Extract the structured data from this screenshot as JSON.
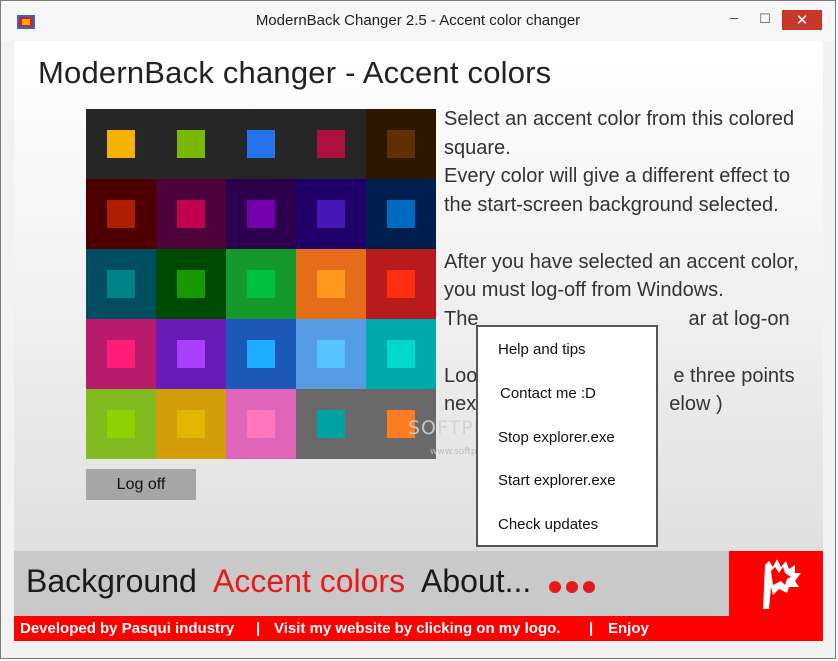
{
  "window": {
    "title": "ModernBack Changer 2.5 - Accent color changer",
    "controls": {
      "minimize": "─",
      "maximize": "☐",
      "close": "✕"
    }
  },
  "main": {
    "heading": "ModernBack changer - Accent colors",
    "grid": [
      {
        "bg": "#262626",
        "swatch": "#f4b300"
      },
      {
        "bg": "#262626",
        "swatch": "#78ba00"
      },
      {
        "bg": "#262626",
        "swatch": "#2673ec"
      },
      {
        "bg": "#262626",
        "swatch": "#ae113d"
      },
      {
        "bg": "#2d1700",
        "swatch": "#632f00"
      },
      {
        "bg": "#4e0000",
        "swatch": "#b01e00"
      },
      {
        "bg": "#4e0038",
        "swatch": "#c1004f"
      },
      {
        "bg": "#2d004e",
        "swatch": "#7200ac"
      },
      {
        "bg": "#1f0068",
        "swatch": "#4617b4"
      },
      {
        "bg": "#001e4e",
        "swatch": "#006ac1"
      },
      {
        "bg": "#004d60",
        "swatch": "#008287"
      },
      {
        "bg": "#004a00",
        "swatch": "#199900"
      },
      {
        "bg": "#15992a",
        "swatch": "#00c13f"
      },
      {
        "bg": "#e56c19",
        "swatch": "#ff981d"
      },
      {
        "bg": "#b81b1b",
        "swatch": "#ff2e12"
      },
      {
        "bg": "#b81b6c",
        "swatch": "#ff1d77"
      },
      {
        "bg": "#691bb8",
        "swatch": "#aa40ff"
      },
      {
        "bg": "#1b58b8",
        "swatch": "#1faeff"
      },
      {
        "bg": "#569ce3",
        "swatch": "#56c5ff"
      },
      {
        "bg": "#00aaaa",
        "swatch": "#00d8cc"
      },
      {
        "bg": "#83ba1f",
        "swatch": "#91d100"
      },
      {
        "bg": "#d39d09",
        "swatch": "#e1b700"
      },
      {
        "bg": "#e064b7",
        "swatch": "#ff76bc"
      },
      {
        "bg": "#696969",
        "swatch": "#00a3a3"
      },
      {
        "bg": "#696969",
        "swatch": "#fe7c22"
      }
    ],
    "description": {
      "p1": "Select an accent color from this colored square.",
      "p2": "Every color will give a different effect to the start-screen background selected.",
      "p3": "After you have selected an accent color, you must log-off from Windows.",
      "p4": "The",
      "p4_tail": "ar at log-on",
      "p5": "Loo",
      "p5_tail": "e three points",
      "p6": "nex",
      "p6_tail": "elow )"
    },
    "logoff_label": "Log off",
    "watermark": "SOFTPEDIA",
    "watermark_sub": "www.softpedia.com"
  },
  "context_menu": {
    "items": [
      "Help and tips",
      "Contact me :D",
      "Stop explorer.exe",
      "Start explorer.exe",
      "Check updates"
    ]
  },
  "nav": {
    "background": "Background",
    "accent": "Accent colors",
    "about": "About..."
  },
  "footer": {
    "developed": "Developed by Pasqui industry",
    "sep1": "|",
    "website": "Visit my website by clicking on my logo.",
    "sep2": "|",
    "enjoy": "Enjoy"
  },
  "colors": {
    "accent_red": "#e8191b",
    "footer_red": "#ff0000",
    "close_button": "#c7372c"
  }
}
